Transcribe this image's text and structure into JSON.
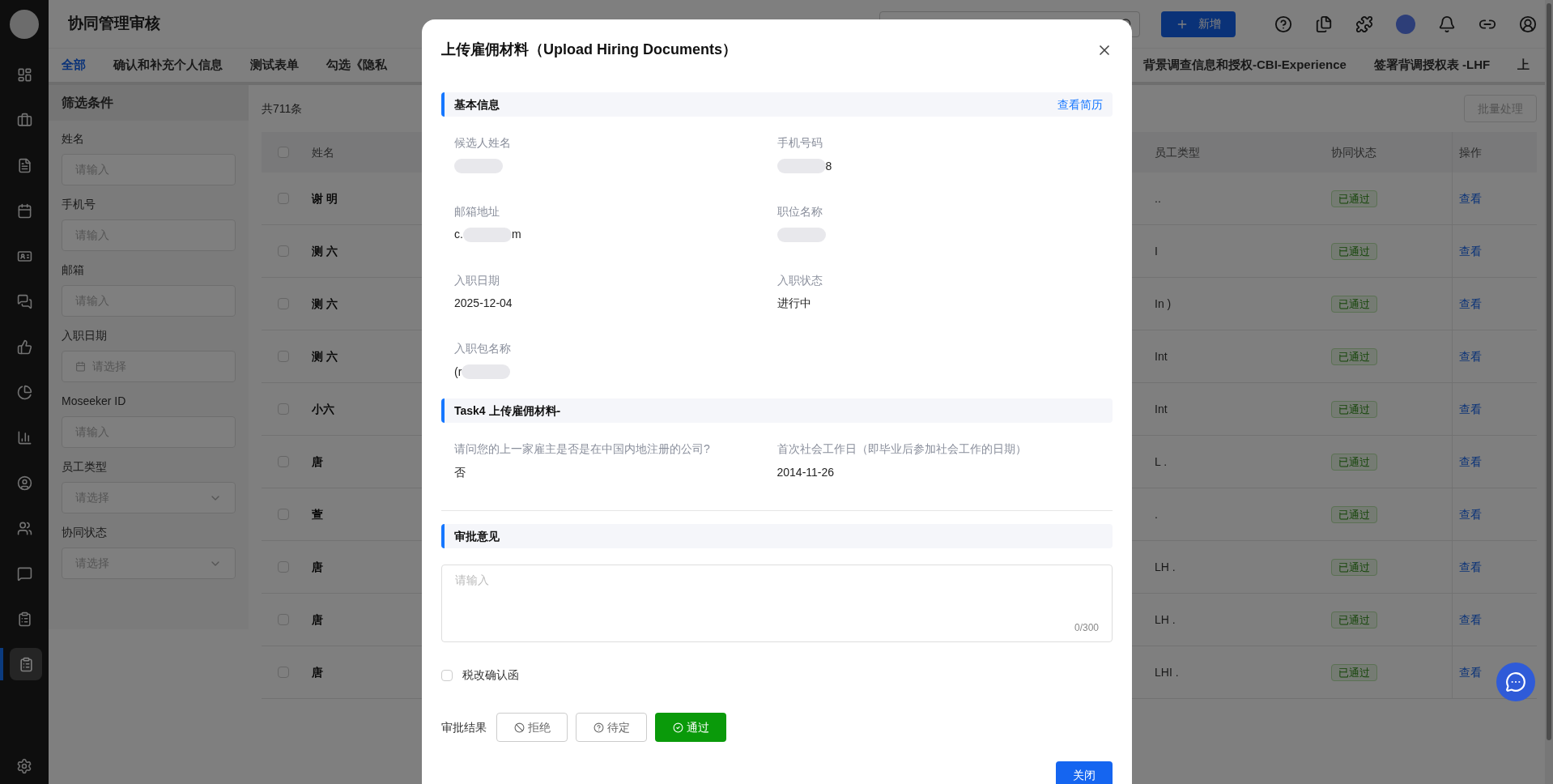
{
  "header": {
    "title": "协同管理审核",
    "add_button": "新增"
  },
  "tabs": [
    {
      "label": "全部",
      "selected": true
    },
    {
      "label": "确认和补充个人信息",
      "selected": false
    },
    {
      "label": "测试表单",
      "selected": false
    },
    {
      "label": "勾选《隐私",
      "selected": false
    },
    {
      "label": "背景调查信息和授权-CBI-Experience",
      "selected": false
    },
    {
      "label": "签署背调授权表 -LHF",
      "selected": false
    },
    {
      "label": "上",
      "selected": false
    }
  ],
  "sidebar": {
    "items": [
      {
        "selected": false
      },
      {
        "selected": false
      },
      {
        "selected": false
      },
      {
        "selected": false
      },
      {
        "selected": false
      },
      {
        "selected": false
      },
      {
        "selected": false
      },
      {
        "selected": false
      },
      {
        "selected": false
      },
      {
        "selected": false
      },
      {
        "selected": false
      },
      {
        "selected": false
      },
      {
        "selected": false
      },
      {
        "selected": true
      }
    ]
  },
  "filters": {
    "title": "筛选条件",
    "fields": [
      {
        "label": "姓名",
        "kind": "input",
        "placeholder": "请输入"
      },
      {
        "label": "手机号",
        "kind": "input",
        "placeholder": "请输入"
      },
      {
        "label": "邮箱",
        "kind": "input",
        "placeholder": "请输入"
      },
      {
        "label": "入职日期",
        "kind": "date",
        "placeholder": "请选择"
      },
      {
        "label": "Moseeker ID",
        "kind": "input",
        "placeholder": "请输入"
      },
      {
        "label": "员工类型",
        "kind": "select",
        "placeholder": "请选择"
      },
      {
        "label": "协同状态",
        "kind": "select",
        "placeholder": "请选择"
      }
    ]
  },
  "table": {
    "count": "共711条",
    "batch_button": "批量处理",
    "all_checked": false,
    "columns": [
      "姓名",
      "员工类型",
      "协同状态",
      "操作"
    ],
    "rows": [
      {
        "checked": false,
        "name": "谢 明",
        "type": "..",
        "status": "已通过",
        "action": "查看"
      },
      {
        "checked": false,
        "name": "测 六",
        "type": "I",
        "status": "已通过",
        "action": "查看"
      },
      {
        "checked": false,
        "name": "测 六",
        "type": "In )",
        "status": "已通过",
        "action": "查看"
      },
      {
        "checked": false,
        "name": "测 六",
        "type": "Int",
        "status": "已通过",
        "action": "查看"
      },
      {
        "checked": false,
        "name": "小六",
        "type": "Int",
        "status": "已通过",
        "action": "查看"
      },
      {
        "checked": false,
        "name": "唐",
        "type": "L .",
        "status": "已通过",
        "action": "查看"
      },
      {
        "checked": false,
        "name": "萱",
        "type": ".",
        "status": "已通过",
        "action": "查看"
      },
      {
        "checked": false,
        "name": "唐",
        "type": "LH .",
        "status": "已通过",
        "action": "查看"
      },
      {
        "checked": false,
        "name": "唐",
        "type": "LH .",
        "status": "已通过",
        "action": "查看"
      },
      {
        "checked": false,
        "name": "唐",
        "type": "LHI .",
        "status": "已通过",
        "action": "查看"
      }
    ]
  },
  "modal": {
    "title": "上传雇佣材料（Upload Hiring Documents）",
    "basic": {
      "title": "基本信息",
      "link": "查看简历",
      "fields": [
        {
          "label": "候选人姓名",
          "redacted": true
        },
        {
          "label": "手机号码",
          "after": "8",
          "redacted": true
        },
        {
          "label": "邮箱地址",
          "before": "c.",
          "after": "m",
          "redacted": true
        },
        {
          "label": "职位名称",
          "redacted": true
        },
        {
          "label": "入职日期",
          "before": "2025-12-04",
          "redacted": false
        },
        {
          "label": "入职状态",
          "before": "进行中",
          "redacted": false
        },
        {
          "label": "入职包名称",
          "before": "(r",
          "redacted": true
        }
      ]
    },
    "task": {
      "title": "Task4 上传雇佣材料-",
      "fields": [
        {
          "label": "请问您的上一家雇主是否是在中国内地注册的公司?",
          "before": "否",
          "redacted": false
        },
        {
          "label": "首次社会工作日（即毕业后参加社会工作的日期）",
          "before": "2014-11-26",
          "redacted": false
        }
      ]
    },
    "opinion": {
      "title": "审批意见",
      "placeholder": "请输入",
      "counter": "0/300"
    },
    "checkbox": {
      "label": "税改确认函",
      "checked": false
    },
    "result": {
      "label": "审批结果",
      "options": [
        {
          "label": "拒绝",
          "selected": false
        },
        {
          "label": "待定",
          "selected": false
        },
        {
          "label": "通过",
          "selected": true
        }
      ]
    },
    "close_button": "关闭"
  }
}
